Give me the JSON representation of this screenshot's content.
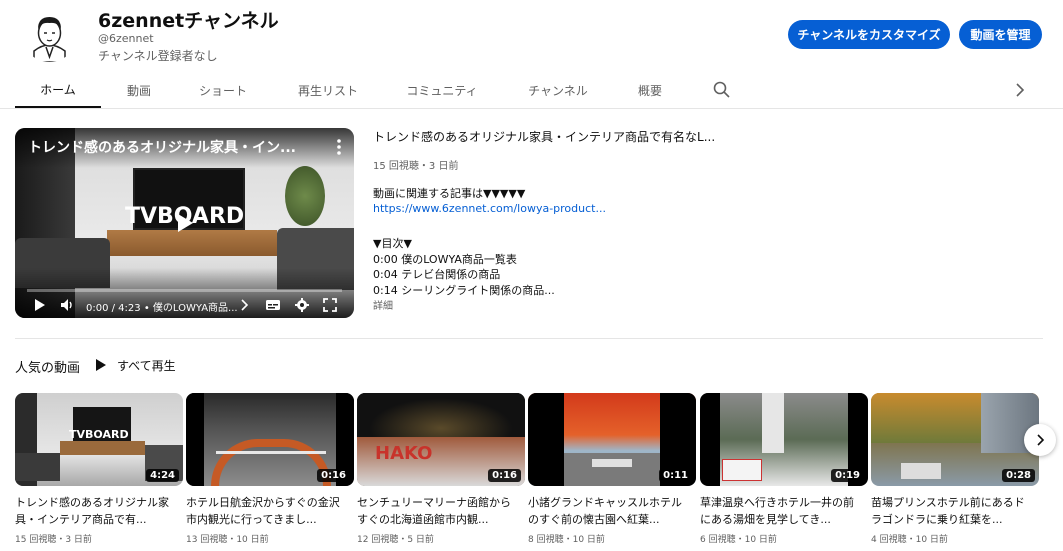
{
  "channel": {
    "name": "6zennetチャンネル",
    "handle": "@6zennet",
    "subscribers": "チャンネル登録者なし",
    "customize_label": "チャンネルをカスタマイズ",
    "manage_label": "動画を管理"
  },
  "tabs": [
    {
      "label": "ホーム",
      "active": true
    },
    {
      "label": "動画"
    },
    {
      "label": "ショート"
    },
    {
      "label": "再生リスト"
    },
    {
      "label": "コミュニティ"
    },
    {
      "label": "チャンネル"
    },
    {
      "label": "概要"
    }
  ],
  "featured": {
    "overlay_title": "トレンド感のあるオリジナル家具・イン...",
    "brand_text": "TVBOARD",
    "time": "0:00 / 4:23",
    "chapter": "• 僕のLOWYA商品...",
    "title": "トレンド感のあるオリジナル家具・インテリア商品で有名なL...",
    "meta": "15 回視聴・3 日前",
    "lines": [
      "動画に関連する記事は▼▼▼▼▼",
      "https://www.6zennet.com/lowya-product...",
      "▼目次▼",
      "0:00 僕のLOWYA商品一覧表",
      "0:04 テレビ台関係の商品",
      "0:14 シーリングライト関係の商品..."
    ],
    "more": "詳細"
  },
  "shelf": {
    "title": "人気の動画",
    "play_all": "すべて再生",
    "videos": [
      {
        "title": "トレンド感のあるオリジナル家具・インテリア商品で有...",
        "duration": "4:24",
        "meta": "15 回視聴・3 日前",
        "thumb_text": "TVBOARD"
      },
      {
        "title": "ホテル日航金沢からすぐの金沢市内観光に行ってきまし...",
        "duration": "0:16",
        "meta": "13 回視聴・10 日前"
      },
      {
        "title": "センチュリーマリーナ函館からすぐの北海道函館市内観...",
        "duration": "0:16",
        "meta": "12 回視聴・5 日前",
        "thumb_text": "HAKO"
      },
      {
        "title": "小諸グランドキャッスルホテルのすぐ前の懐古園へ紅葉...",
        "duration": "0:11",
        "meta": "8 回視聴・10 日前"
      },
      {
        "title": "草津温泉へ行きホテル一井の前にある湯畑を見学してき...",
        "duration": "0:19",
        "meta": "6 回視聴・10 日前"
      },
      {
        "title": "苗場プリンスホテル前にあるドラゴンドラに乗り紅葉を...",
        "duration": "0:28",
        "meta": "4 回視聴・10 日前"
      }
    ]
  },
  "icons": {
    "search": "search-icon",
    "chevron": "chevron-right-icon"
  }
}
